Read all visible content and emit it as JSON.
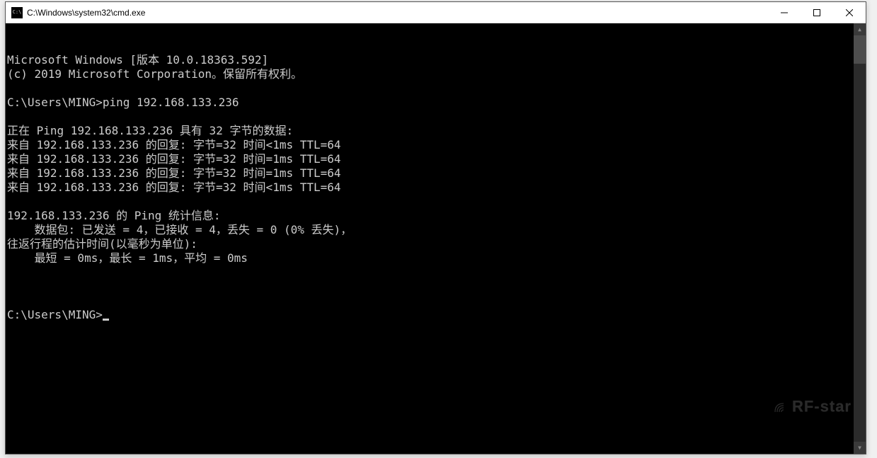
{
  "window": {
    "title": "C:\\Windows\\system32\\cmd.exe"
  },
  "console": {
    "lines": [
      "Microsoft Windows [版本 10.0.18363.592]",
      "(c) 2019 Microsoft Corporation。保留所有权利。",
      "",
      "C:\\Users\\MING>ping 192.168.133.236",
      "",
      "正在 Ping 192.168.133.236 具有 32 字节的数据:",
      "来自 192.168.133.236 的回复: 字节=32 时间<1ms TTL=64",
      "来自 192.168.133.236 的回复: 字节=32 时间=1ms TTL=64",
      "来自 192.168.133.236 的回复: 字节=32 时间=1ms TTL=64",
      "来自 192.168.133.236 的回复: 字节=32 时间<1ms TTL=64",
      "",
      "192.168.133.236 的 Ping 统计信息:",
      "    数据包: 已发送 = 4，已接收 = 4，丢失 = 0 (0% 丢失)，",
      "往返行程的估计时间(以毫秒为单位):",
      "    最短 = 0ms，最长 = 1ms，平均 = 0ms",
      ""
    ],
    "prompt": "C:\\Users\\MING>"
  },
  "watermark": "RF-star"
}
